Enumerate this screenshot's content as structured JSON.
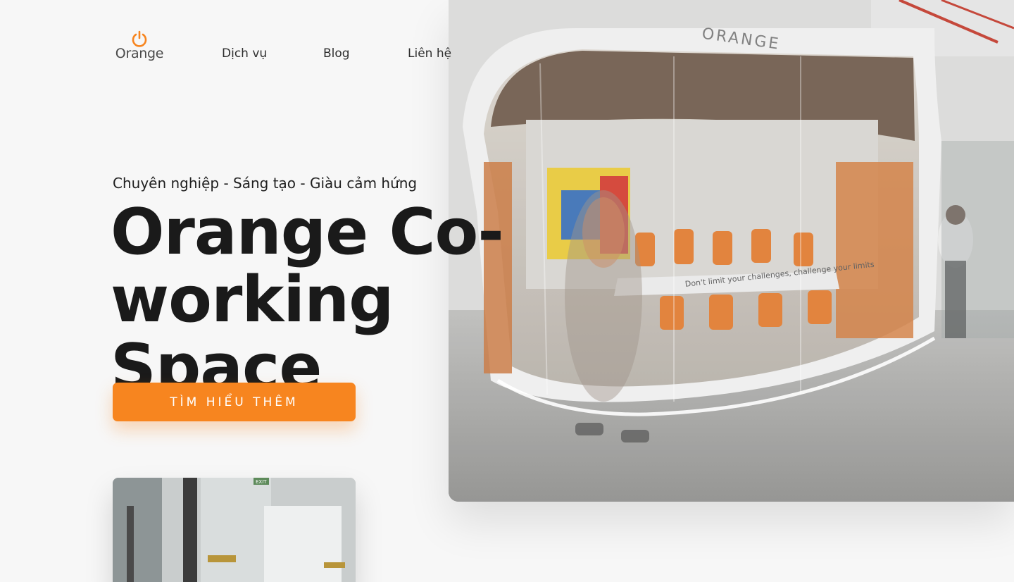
{
  "nav": {
    "logo_text": "Orange",
    "logo_icon": "power-icon",
    "links": [
      "Dịch vụ",
      "Blog",
      "Liên hệ"
    ]
  },
  "hero": {
    "tagline": "Chuyên nghiệp - Sáng tạo - Giàu cảm hứng",
    "title_line1": "Orange Co-",
    "title_line2": "working Space",
    "cta_label": "TÌM HIỂU THÊM",
    "image_sign": "ORANGE",
    "glass_text": "Don't limit your challenges, challenge your limits"
  },
  "thumb": {
    "exit_sign": "EXIT"
  },
  "colors": {
    "accent": "#f7851f",
    "background": "#f7f7f7",
    "text": "#1a1a1a"
  }
}
